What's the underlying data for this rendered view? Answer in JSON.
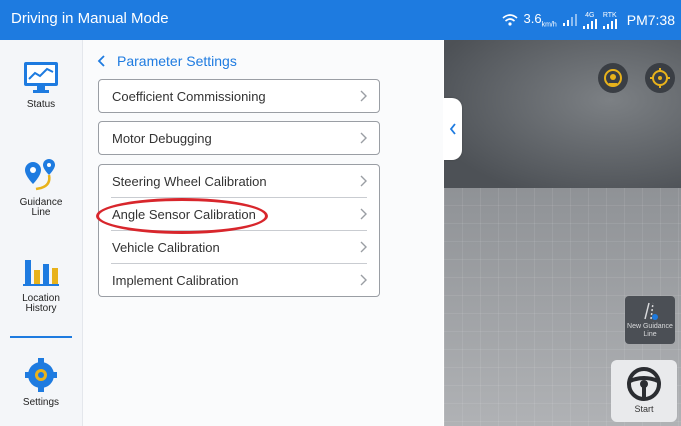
{
  "status_bar": {
    "title": "Driving in Manual Mode",
    "speed_value": "3.6",
    "speed_unit": "km/h",
    "signal_top_label": "4G",
    "rtk_label": "RTK",
    "time": "PM7:38",
    "background": "#1e7be0"
  },
  "sidebar": {
    "items": [
      {
        "label": "Status",
        "icon": "monitor-chart-icon"
      },
      {
        "label": "Guidance Line",
        "icon": "route-pins-icon"
      },
      {
        "label": "Location History",
        "icon": "bar-chart-icon"
      },
      {
        "label": "Settings",
        "icon": "gear-icon",
        "active": true
      }
    ]
  },
  "main": {
    "breadcrumb": "Parameter Settings",
    "groups": [
      {
        "rows": [
          "Coefficient Commissioning"
        ]
      },
      {
        "rows": [
          "Motor Debugging"
        ]
      },
      {
        "rows": [
          "Steering Wheel Calibration",
          "Angle Sensor Calibration",
          "Vehicle Calibration",
          "Implement Calibration"
        ]
      }
    ],
    "highlight_color": "#d8262c"
  },
  "view": {
    "new_guidance_line_label": "New Guidance Line",
    "start_label": "Start",
    "accent": "#e8b21b"
  }
}
